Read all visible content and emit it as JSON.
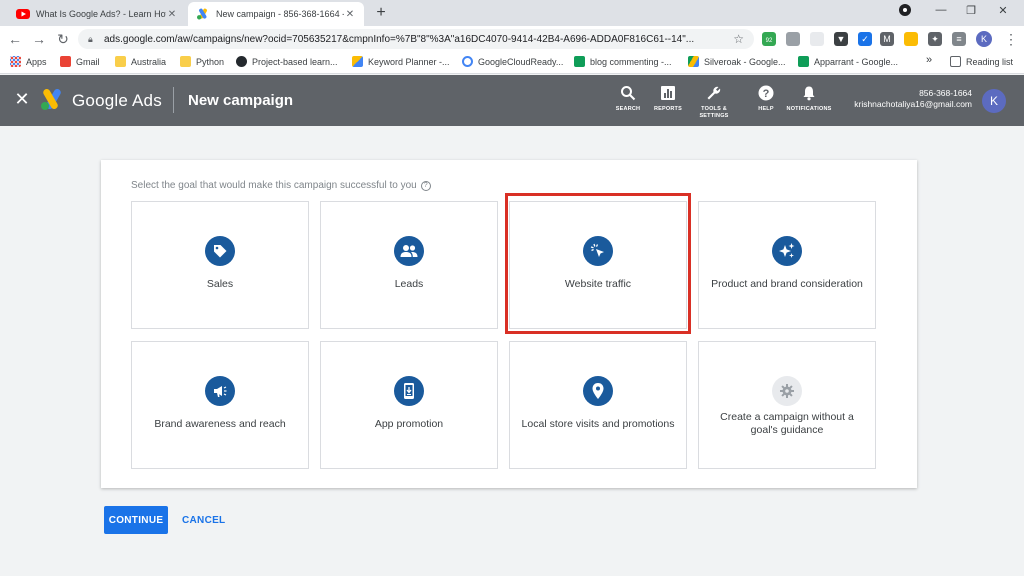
{
  "browser": {
    "tabs": [
      {
        "title": "What Is Google Ads? - Learn How",
        "favicon": "youtube-icon",
        "active": false
      },
      {
        "title": "New campaign - 856-368-1664 - ",
        "favicon": "google-ads-icon",
        "active": true
      }
    ],
    "url": "ads.google.com/aw/campaigns/new?ocid=705635217&cmpnInfo=%7B\"8\"%3A\"a16DC4070-9414-42B4-A696-ADDA0F816C61--14\"...",
    "extension_badge": "92",
    "profile_initial": "K",
    "bookmarks": [
      {
        "label": "Apps",
        "icon": "apps-grid-icon"
      },
      {
        "label": "Gmail",
        "icon": "gmail-icon"
      },
      {
        "label": "Australia",
        "icon": "folder-icon"
      },
      {
        "label": "Python",
        "icon": "folder-icon"
      },
      {
        "label": "Project-based learn...",
        "icon": "github-icon"
      },
      {
        "label": "Keyword Planner -...",
        "icon": "google-ads-icon"
      },
      {
        "label": "GoogleCloudReady...",
        "icon": "google-icon"
      },
      {
        "label": "blog commenting -...",
        "icon": "sheets-icon"
      },
      {
        "label": "Silveroak - Google...",
        "icon": "drive-icon"
      },
      {
        "label": "Apparrant - Google...",
        "icon": "sheets-icon"
      }
    ],
    "more_bookmarks": "»",
    "reading_list": "Reading list"
  },
  "header": {
    "brand": "Google Ads",
    "page_title": "New campaign",
    "icons": [
      {
        "label": "SEARCH",
        "icon": "search-icon"
      },
      {
        "label": "REPORTS",
        "icon": "reports-icon"
      },
      {
        "label": "TOOLS &",
        "label2": "SETTINGS",
        "icon": "wrench-icon"
      },
      {
        "label": "HELP",
        "icon": "help-icon"
      },
      {
        "label": "NOTIFICATIONS",
        "icon": "bell-icon"
      }
    ],
    "account_id": "856-368-1664",
    "account_email": "krishnachotaliya16@gmail.com",
    "avatar_initial": "K"
  },
  "main": {
    "prompt": "Select the goal that would make this campaign successful to you",
    "goals": [
      {
        "label": "Sales",
        "icon": "tag-icon",
        "selected": false
      },
      {
        "label": "Leads",
        "icon": "people-icon",
        "selected": false
      },
      {
        "label": "Website traffic",
        "icon": "cursor-click-icon",
        "selected": true
      },
      {
        "label": "Product and brand consideration",
        "icon": "sparkle-icon",
        "selected": false
      },
      {
        "label": "Brand awareness and reach",
        "icon": "megaphone-icon",
        "selected": false
      },
      {
        "label": "App promotion",
        "icon": "phone-download-icon",
        "selected": false
      },
      {
        "label": "Local store visits and promotions",
        "icon": "location-pin-icon",
        "selected": false
      },
      {
        "label": "Create a campaign without a goal's guidance",
        "icon": "gear-icon",
        "selected": false
      }
    ],
    "continue_label": "CONTINUE",
    "cancel_label": "CANCEL"
  },
  "colors": {
    "header_bg": "#5f6368",
    "goal_icon_bg": "#1a5a9c",
    "primary": "#1a73e8",
    "highlight": "#d93025"
  }
}
